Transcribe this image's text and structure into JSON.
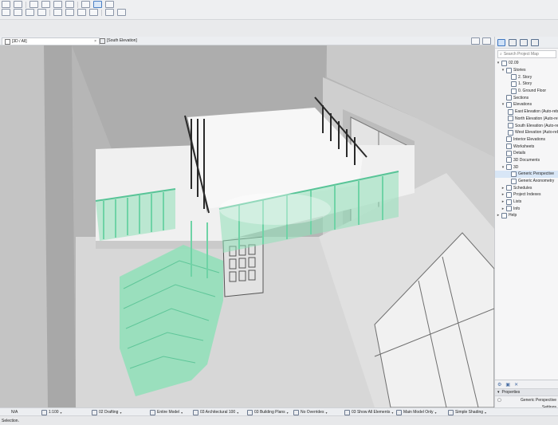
{
  "tabs": [
    {
      "label": "[3D / All]"
    },
    {
      "label": "[South Elevation]"
    }
  ],
  "navigator": {
    "search_placeholder": "Search Project Map",
    "items": [
      {
        "label": "02.09",
        "depth": 0,
        "chevron": "v"
      },
      {
        "label": "Stories",
        "depth": 1,
        "chevron": "v"
      },
      {
        "label": "2. Story",
        "depth": 2,
        "chevron": ""
      },
      {
        "label": "1. Story",
        "depth": 2,
        "chevron": ""
      },
      {
        "label": "0. Ground Floor",
        "depth": 2,
        "chevron": ""
      },
      {
        "label": "Sections",
        "depth": 1,
        "chevron": ""
      },
      {
        "label": "Elevations",
        "depth": 1,
        "chevron": "v"
      },
      {
        "label": "East Elevation (Auto-rebuild Model)",
        "depth": 2,
        "chevron": ""
      },
      {
        "label": "North Elevation (Auto-rebuild Model)",
        "depth": 2,
        "chevron": ""
      },
      {
        "label": "South Elevation (Auto-rebuild Model)",
        "depth": 2,
        "chevron": ""
      },
      {
        "label": "West Elevation (Auto-rebuild Model)",
        "depth": 2,
        "chevron": ""
      },
      {
        "label": "Interior Elevations",
        "depth": 1,
        "chevron": ""
      },
      {
        "label": "Worksheets",
        "depth": 1,
        "chevron": ""
      },
      {
        "label": "Details",
        "depth": 1,
        "chevron": ""
      },
      {
        "label": "3D Documents",
        "depth": 1,
        "chevron": ""
      },
      {
        "label": "3D",
        "depth": 1,
        "chevron": "v"
      },
      {
        "label": "Generic Perspective",
        "depth": 2,
        "chevron": "",
        "selected": true
      },
      {
        "label": "Generic Axonometry",
        "depth": 2,
        "chevron": ""
      },
      {
        "label": "Schedules",
        "depth": 1,
        "chevron": ">"
      },
      {
        "label": "Project Indexes",
        "depth": 1,
        "chevron": ">"
      },
      {
        "label": "Lists",
        "depth": 1,
        "chevron": ">"
      },
      {
        "label": "Info",
        "depth": 1,
        "chevron": ">"
      },
      {
        "label": "Help",
        "depth": 0,
        "chevron": ">"
      }
    ]
  },
  "properties": {
    "header": "Properties",
    "value": "Generic Perspective",
    "settings_label": "Settings"
  },
  "statusbar": {
    "zoom": "N/A",
    "scale": "1:100",
    "layer_combo": "02 Drafting",
    "model": "Entire Model",
    "pen_set": "03 Architectural 100",
    "model_view": "03 Building Plans",
    "overrides": "No Overrides",
    "renovation": "03 Show All Elements",
    "structural": "Main Model Only",
    "shading": "Simple Shading"
  },
  "message": "Selection.",
  "colors": {
    "railing_green": "#7fdcb2",
    "wall_gray": "#bdbdbd",
    "slab_white": "#f2f2f2",
    "accent_blue": "#3d75c0"
  }
}
